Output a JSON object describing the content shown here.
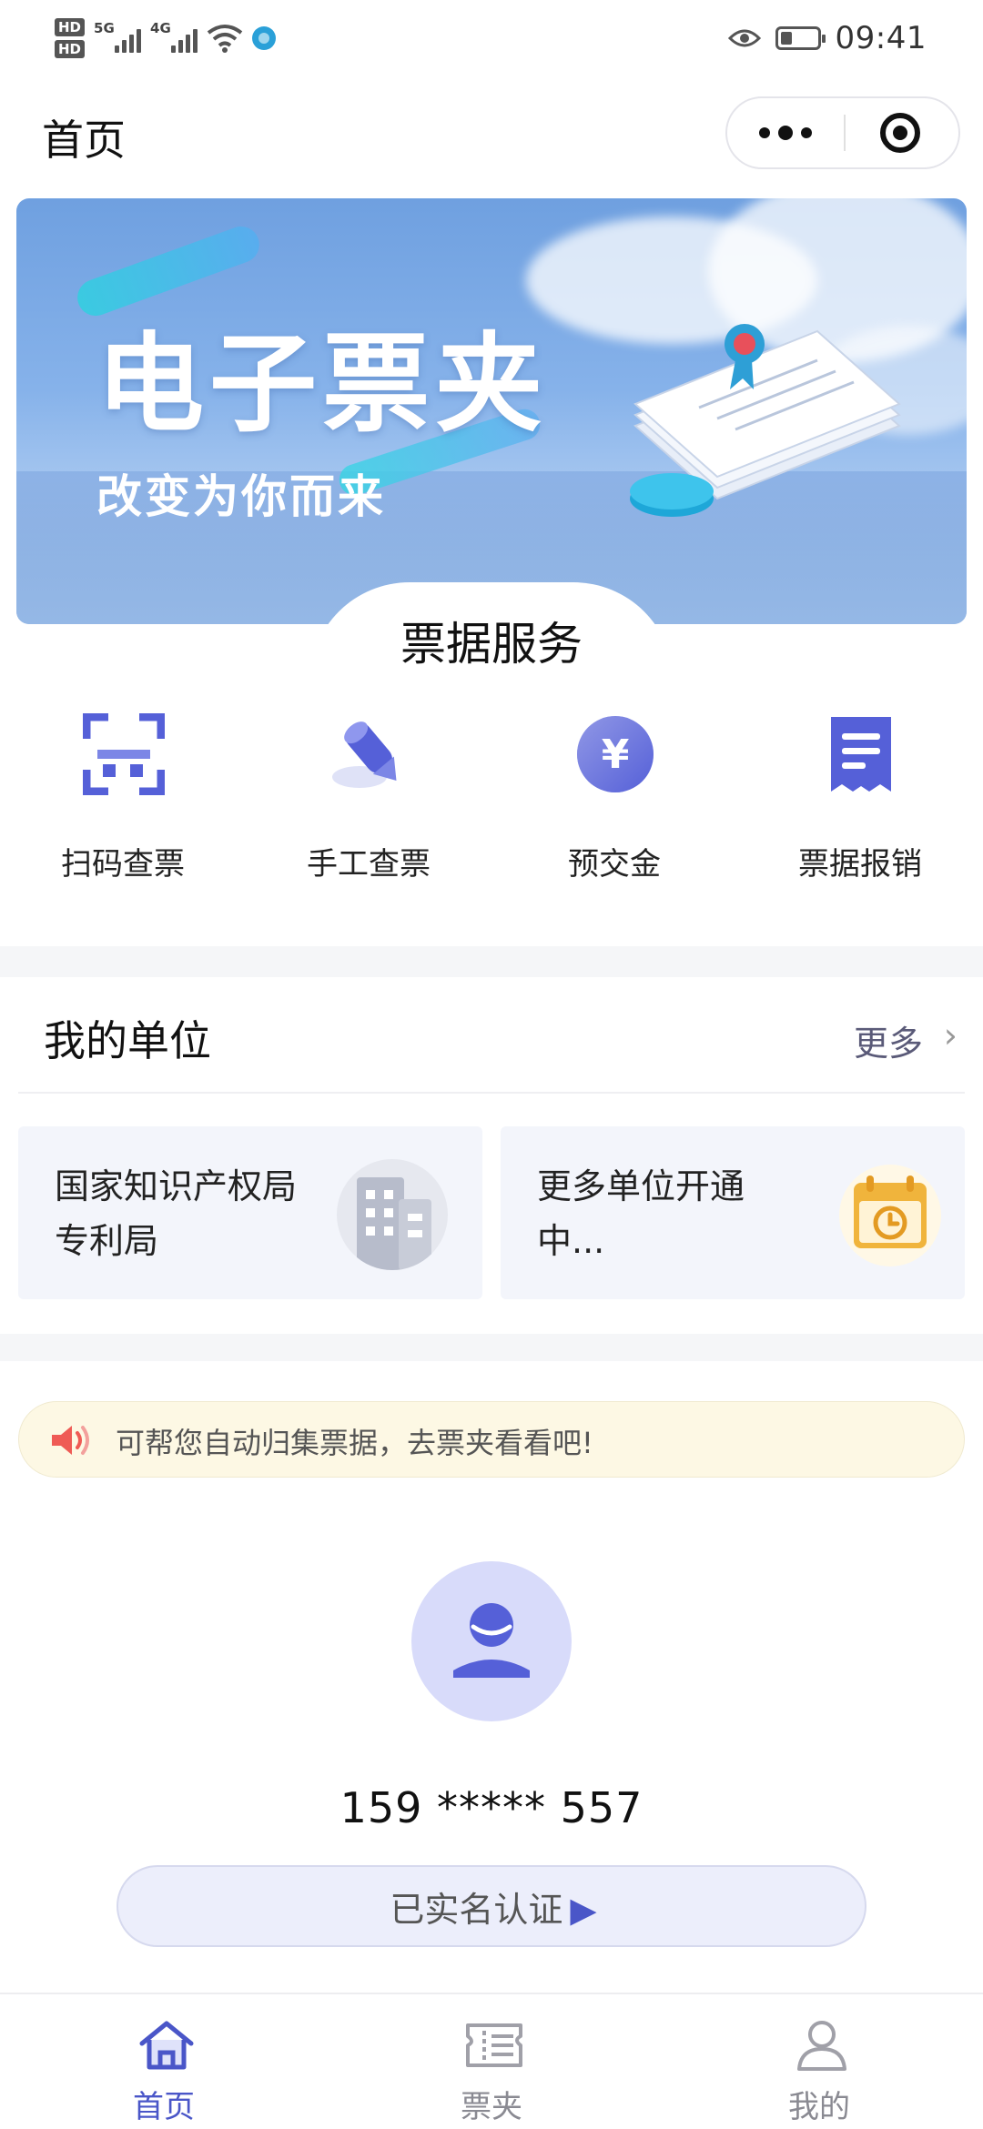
{
  "status_bar": {
    "hd1": "HD",
    "hd2": "HD",
    "sim1": "5G",
    "sim2": "4G",
    "time": "09:41"
  },
  "nav": {
    "title": "首页"
  },
  "banner": {
    "title": "电子票夹",
    "subtitle": "改变为你而来"
  },
  "services": {
    "title": "票据服务",
    "items": [
      {
        "label": "扫码查票",
        "icon": "scan-qr-icon"
      },
      {
        "label": "手工查票",
        "icon": "pen-icon"
      },
      {
        "label": "预交金",
        "icon": "yuan-coin-icon",
        "symbol": "¥"
      },
      {
        "label": "票据报销",
        "icon": "receipt-icon"
      }
    ]
  },
  "units": {
    "title": "我的单位",
    "more": "更多",
    "cards": [
      {
        "name": "国家知识产权局专利局",
        "icon": "building-icon"
      },
      {
        "name": "更多单位开通中...",
        "icon": "calendar-clock-icon"
      }
    ]
  },
  "notice": {
    "text": "可帮您自动归集票据，去票夹看看吧!"
  },
  "profile": {
    "phone": "159 ***** 557",
    "verify_label": "已实名认证",
    "verify_arrow": "▶"
  },
  "tabbar": {
    "items": [
      {
        "label": "首页",
        "active": true,
        "icon": "home-icon"
      },
      {
        "label": "票夹",
        "active": false,
        "icon": "ticket-folder-icon"
      },
      {
        "label": "我的",
        "active": false,
        "icon": "person-icon"
      }
    ]
  },
  "colors": {
    "accent": "#5560d8",
    "banner_blue": "#7aa8e6",
    "notice_bg": "#fdf8e4",
    "calendar_gold": "#f0b43c"
  }
}
